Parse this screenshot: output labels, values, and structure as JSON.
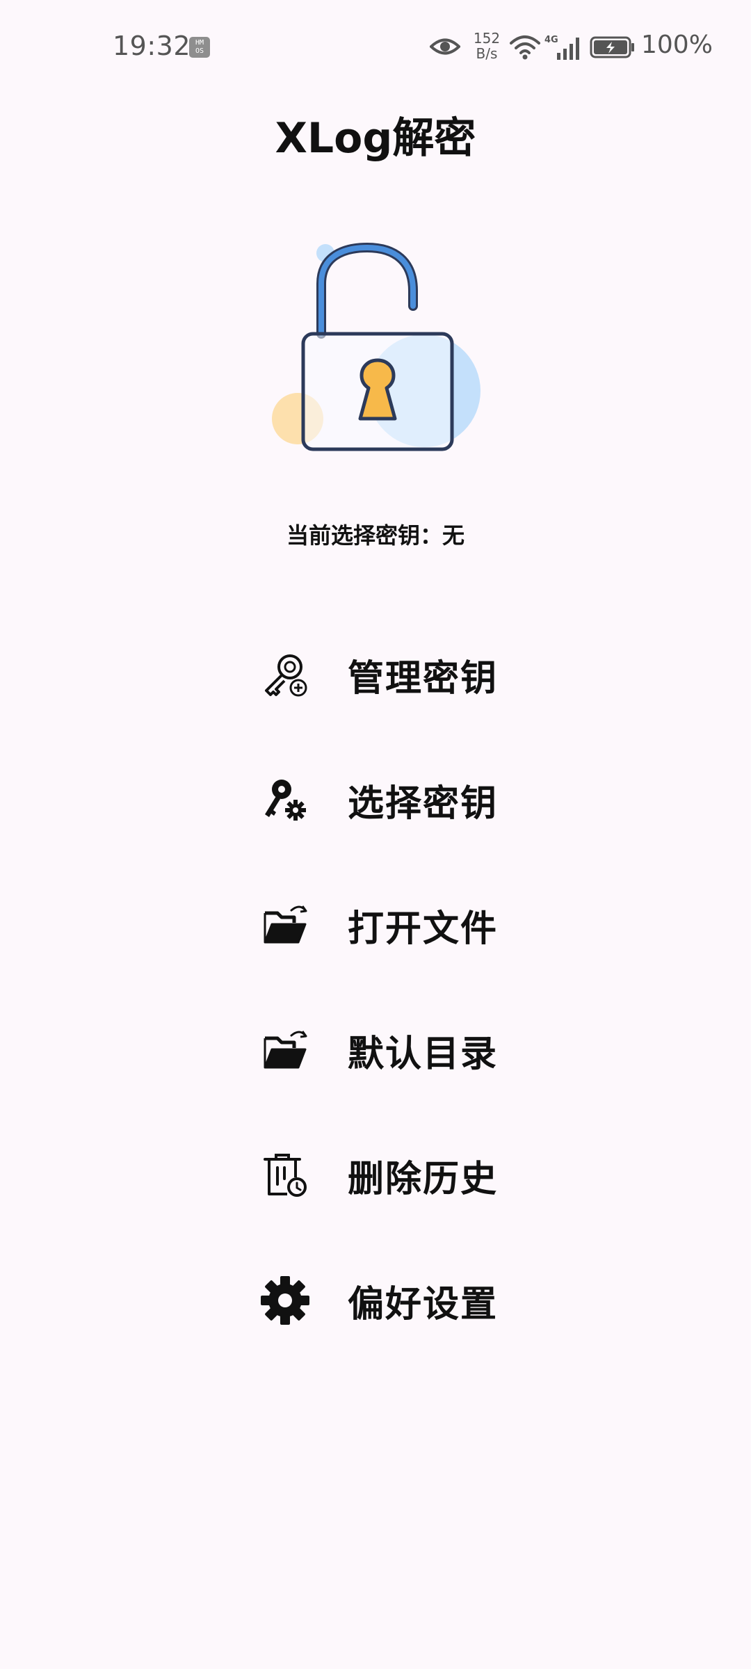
{
  "status_bar": {
    "time": "19:32",
    "hmos_badge": "HM\nOS",
    "net_speed_value": "152",
    "net_speed_unit": "B/s",
    "battery_percent": "100%",
    "icons": [
      "eye-icon",
      "wifi-icon",
      "signal-4g-icon",
      "battery-charging-icon"
    ]
  },
  "app": {
    "title": "XLog解密",
    "current_key_label": "当前选择密钥：无"
  },
  "illustration": {
    "name": "unlocked-padlock",
    "colors": {
      "shackle": "#4a8edb",
      "body_outline": "#2c3a5a",
      "body_fill": "#f7f9ff",
      "blue_circle": "#c4e0fb",
      "orange_circle": "#fde0ad",
      "keyhole": "#f7b94a"
    }
  },
  "menu": {
    "items": [
      {
        "label": "管理密钥",
        "icon": "key-add-icon"
      },
      {
        "label": "选择密钥",
        "icon": "key-settings-icon"
      },
      {
        "label": "打开文件",
        "icon": "folder-open-icon"
      },
      {
        "label": "默认目录",
        "icon": "folder-default-icon"
      },
      {
        "label": "删除历史",
        "icon": "trash-history-icon"
      },
      {
        "label": "偏好设置",
        "icon": "gear-icon"
      }
    ]
  }
}
